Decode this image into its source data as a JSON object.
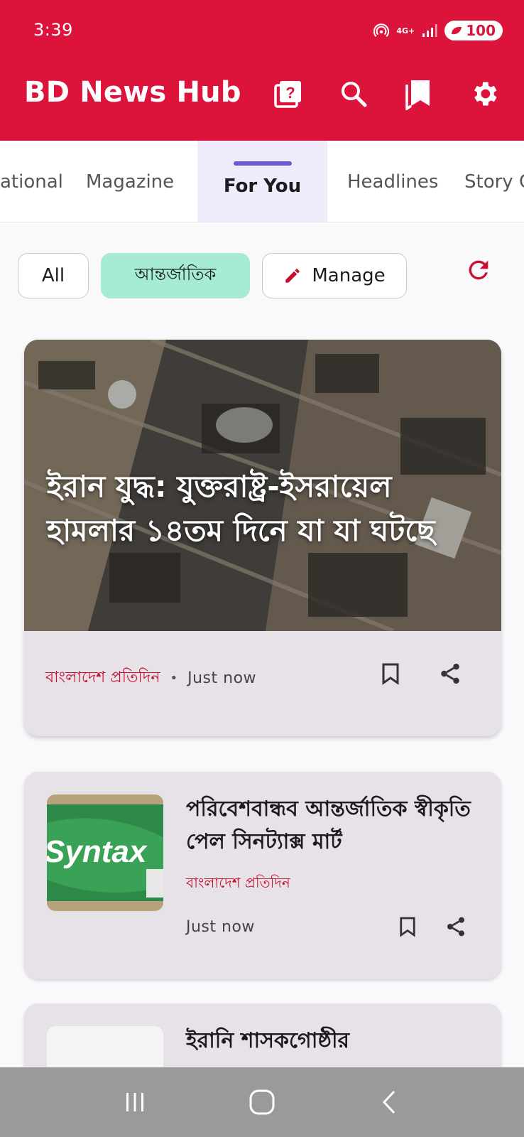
{
  "status": {
    "time": "3:39",
    "network": "4G+",
    "battery": "100"
  },
  "app": {
    "title": "BD News Hub"
  },
  "icons": {
    "help": "help-icon",
    "search": "search-icon",
    "bookmarks": "bookmarks-icon",
    "settings": "gear-icon"
  },
  "tabs": [
    {
      "label": "ational"
    },
    {
      "label": "Magazine"
    },
    {
      "label": "For You"
    },
    {
      "label": "Headlines"
    },
    {
      "label": "Story C"
    }
  ],
  "chips": {
    "all": "All",
    "selected": "আন্তর্জাতিক",
    "manage": "Manage"
  },
  "hero": {
    "title": "ইরান যুদ্ধ: যুক্তরাষ্ট্র-ইসরায়েল হামলার ১৪তম দিনে যা যা ঘটছে",
    "source": "বাংলাদেশ প্রতিদিন",
    "separator": "•",
    "time": "Just now"
  },
  "articles": [
    {
      "title": "পরিবেশবান্ধব আন্তর্জাতিক স্বীকৃতি পেল সিনট্যাক্স মার্ট",
      "source": "বাংলাদেশ প্রতিদিন",
      "time": "Just now",
      "thumb_text": "Syntax"
    },
    {
      "title": "ইরানি শাসকগোষ্ঠীর"
    }
  ],
  "colors": {
    "primary": "#dc143c",
    "chip_selected": "#a5ecd2",
    "tab_indicator": "#6a5bd4",
    "card_bg": "#e7e1e8",
    "source_text": "#c8102e"
  }
}
